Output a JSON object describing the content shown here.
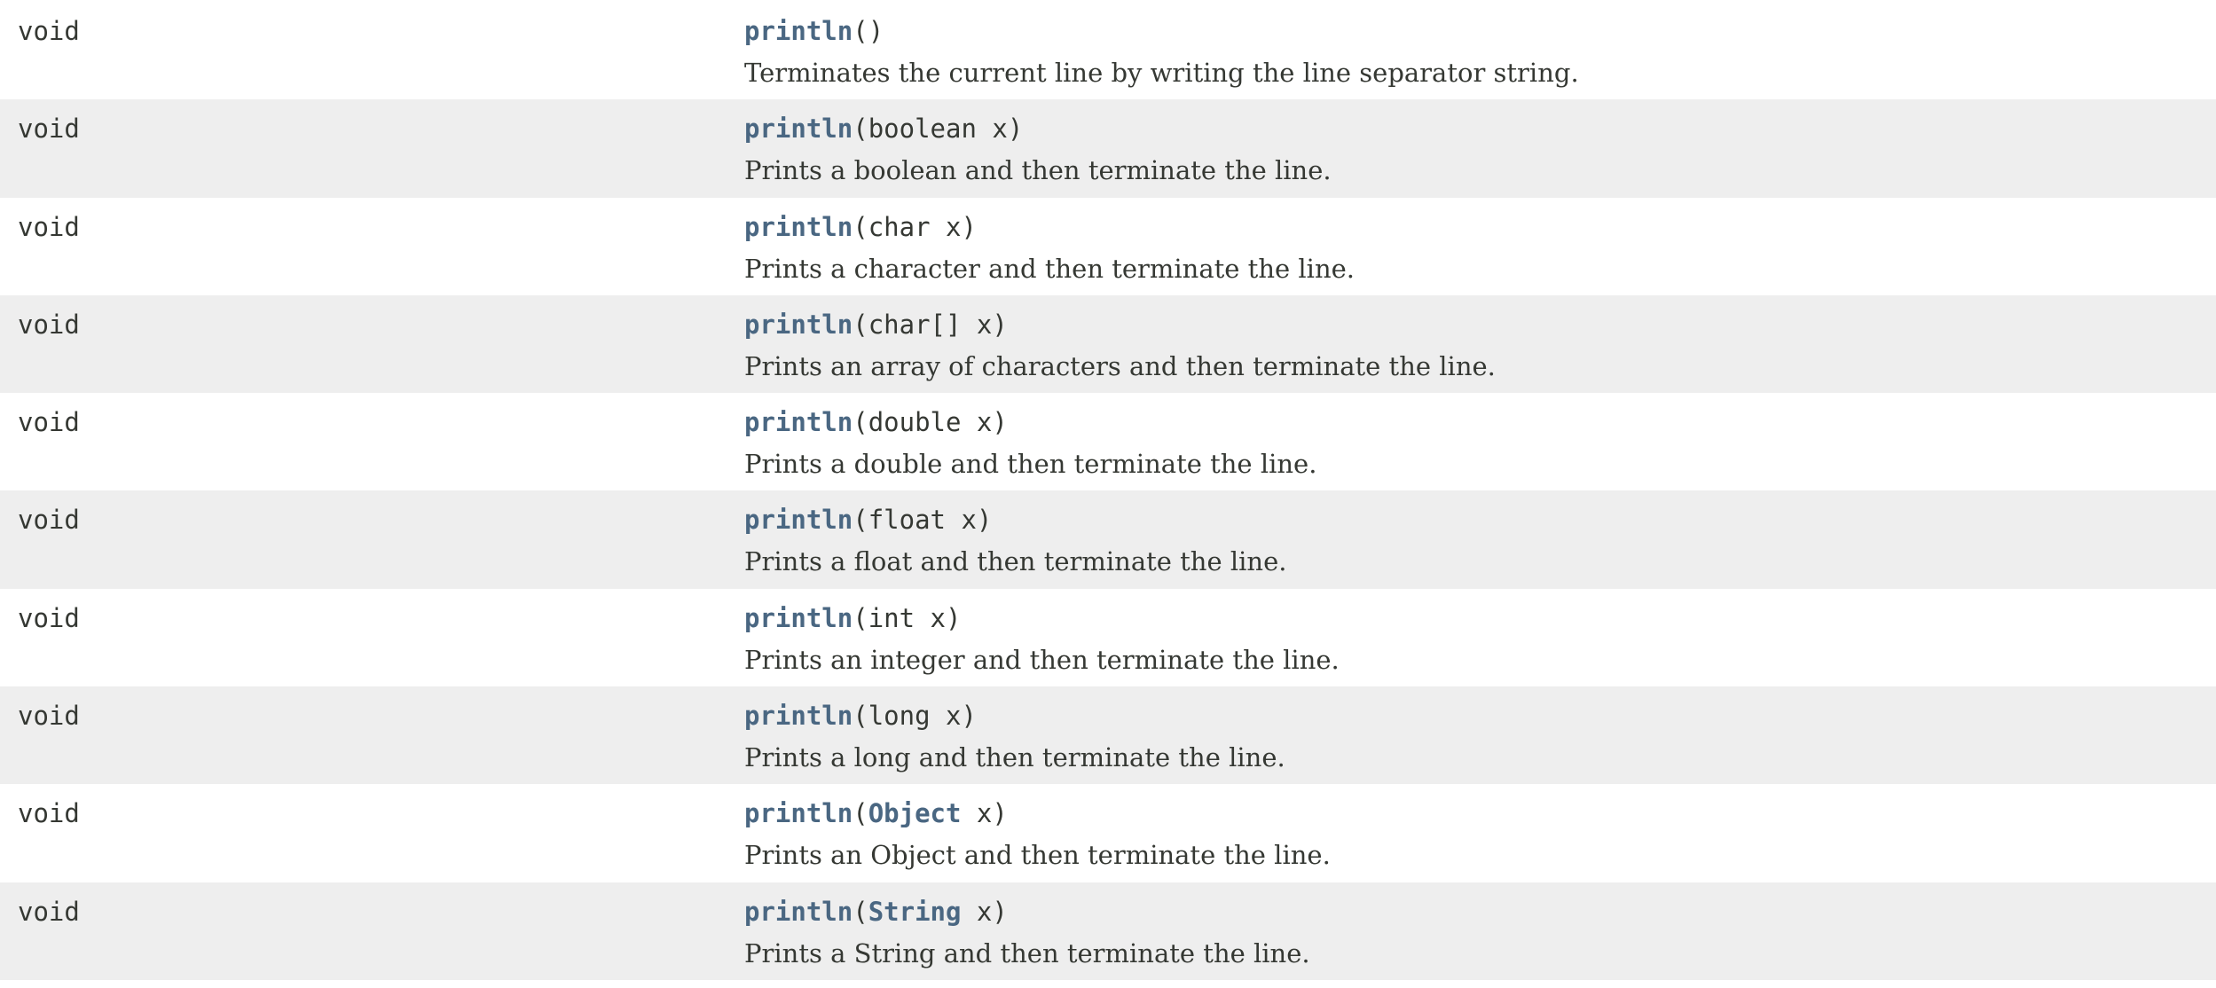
{
  "methods": [
    {
      "return_type": "void",
      "name": "println",
      "open": "(",
      "param_type": "",
      "param_type_link": "",
      "param_rest": ")",
      "description": "Terminates the current line by writing the line separator string."
    },
    {
      "return_type": "void",
      "name": "println",
      "open": "(",
      "param_type": "boolean x",
      "param_type_link": "",
      "param_rest": ")",
      "description": "Prints a boolean and then terminate the line."
    },
    {
      "return_type": "void",
      "name": "println",
      "open": "(",
      "param_type": "char x",
      "param_type_link": "",
      "param_rest": ")",
      "description": "Prints a character and then terminate the line."
    },
    {
      "return_type": "void",
      "name": "println",
      "open": "(",
      "param_type": "char[] x",
      "param_type_link": "",
      "param_rest": ")",
      "description": "Prints an array of characters and then terminate the line."
    },
    {
      "return_type": "void",
      "name": "println",
      "open": "(",
      "param_type": "double x",
      "param_type_link": "",
      "param_rest": ")",
      "description": "Prints a double and then terminate the line."
    },
    {
      "return_type": "void",
      "name": "println",
      "open": "(",
      "param_type": "float x",
      "param_type_link": "",
      "param_rest": ")",
      "description": "Prints a float and then terminate the line."
    },
    {
      "return_type": "void",
      "name": "println",
      "open": "(",
      "param_type": "int x",
      "param_type_link": "",
      "param_rest": ")",
      "description": "Prints an integer and then terminate the line."
    },
    {
      "return_type": "void",
      "name": "println",
      "open": "(",
      "param_type": "long x",
      "param_type_link": "",
      "param_rest": ")",
      "description": "Prints a long and then terminate the line."
    },
    {
      "return_type": "void",
      "name": "println",
      "open": "(",
      "param_type": "",
      "param_type_link": "Object",
      "param_rest": " x)",
      "description": "Prints an Object and then terminate the line."
    },
    {
      "return_type": "void",
      "name": "println",
      "open": "(",
      "param_type": "",
      "param_type_link": "String",
      "param_rest": " x)",
      "description": "Prints a String and then terminate the line."
    }
  ]
}
